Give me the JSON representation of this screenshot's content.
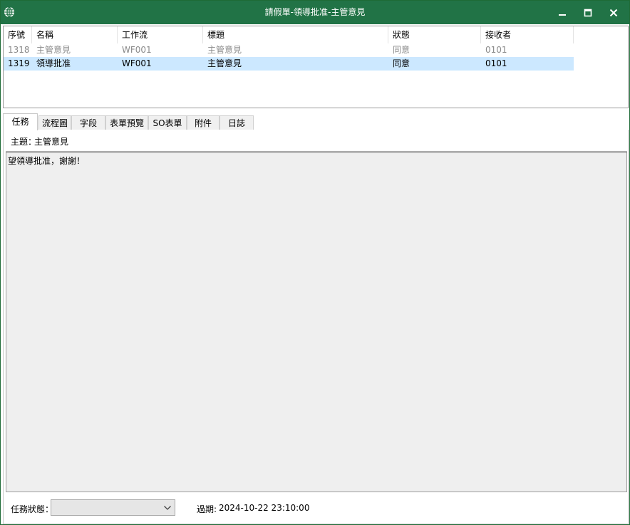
{
  "window": {
    "title": "請假單-領導批准-主管意見",
    "icon": "globe-icon",
    "controls": [
      "minimize-icon",
      "maximize-icon",
      "close-icon"
    ]
  },
  "task_list": {
    "columns": [
      "序號",
      "名稱",
      "工作流",
      "標題",
      "狀態",
      "接收者"
    ],
    "rows": [
      {
        "id": "1318",
        "name": "主管意見",
        "workflow": "WF001",
        "title": "主管意見",
        "status": "同意",
        "receiver": "0101",
        "selected": false
      },
      {
        "id": "1319",
        "name": "領導批准",
        "workflow": "WF001",
        "title": "主管意見",
        "status": "同意",
        "receiver": "0101",
        "selected": true
      }
    ]
  },
  "tabs": [
    {
      "label": "任務",
      "active": true
    },
    {
      "label": "流程圖",
      "active": false
    },
    {
      "label": "字段",
      "active": false
    },
    {
      "label": "表單預覽",
      "active": false
    },
    {
      "label": "SO表單",
      "active": false
    },
    {
      "label": "附件",
      "active": false
    },
    {
      "label": "日誌",
      "active": false
    }
  ],
  "task_panel": {
    "subject_label": "主題：",
    "subject_value": "主管意見",
    "content_text": "望領導批准，謝謝！",
    "status_label": "任務狀態：",
    "status_value": "",
    "due_label": "過期:",
    "due_value": "2024-10-22 23:10:00"
  },
  "colors": {
    "titlebar": "#217346",
    "selected_row": "#cce8ff",
    "content_bg": "#efefef"
  }
}
